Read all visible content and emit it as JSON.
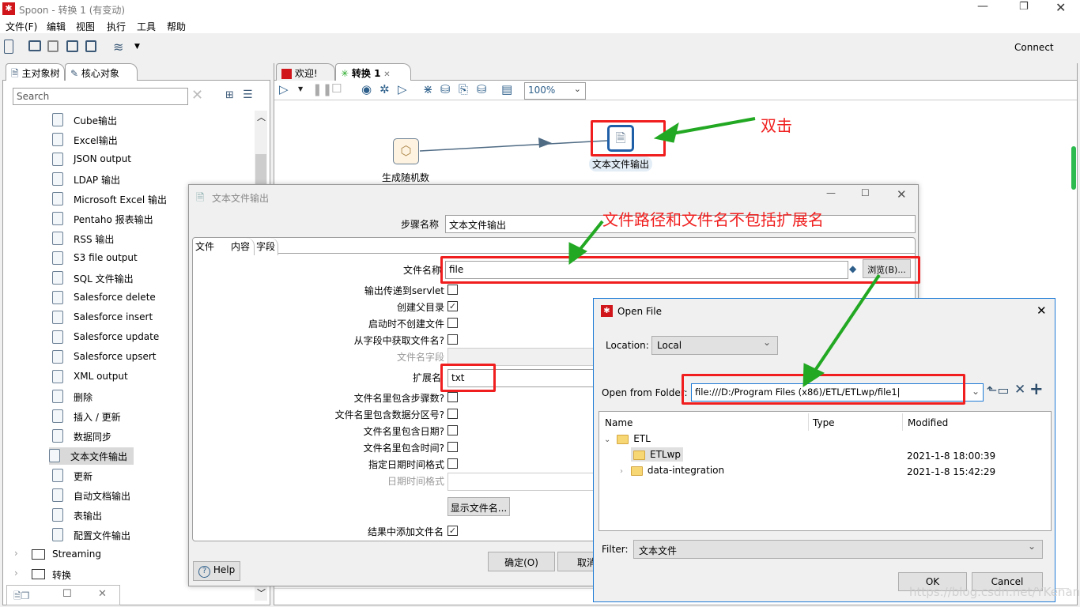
{
  "window": {
    "title": "Spoon - 转换 1 (有变动)",
    "controls": [
      "minimize-icon",
      "maximize-icon",
      "close-icon"
    ]
  },
  "menu": [
    "文件(F)",
    "编辑",
    "视图",
    "执行",
    "工具",
    "帮助"
  ],
  "toolbar": {
    "connect": "Connect"
  },
  "left_panel": {
    "tabs": [
      "主对象树",
      "核心对象"
    ],
    "search_placeholder": "Search",
    "items": [
      "Cube输出",
      "Excel输出",
      "JSON output",
      "LDAP 输出",
      "Microsoft Excel 输出",
      "Pentaho 报表输出",
      "RSS 输出",
      "S3 file output",
      "SQL 文件输出",
      "Salesforce delete",
      "Salesforce insert",
      "Salesforce update",
      "Salesforce upsert",
      "XML output",
      "删除",
      "插入 / 更新",
      "数据同步",
      "文本文件输出",
      "更新",
      "自动文档输出",
      "表输出",
      "配置文件输出"
    ],
    "selected_item": "文本文件输出",
    "folders": [
      "Streaming",
      "转换"
    ]
  },
  "editor": {
    "tabs": [
      "欢迎!",
      "转换 1"
    ],
    "zoom": "100%",
    "nodes": [
      {
        "label": "生成随机数"
      },
      {
        "label": "文本文件输出"
      }
    ]
  },
  "annotations": {
    "double_click": "双击",
    "note": "文件路径和文件名不包括扩展名"
  },
  "step_dialog": {
    "title": "文本文件输出",
    "step_name_label": "步骤名称",
    "step_name": "文本文件输出",
    "tabs": [
      "文件",
      "内容",
      "字段"
    ],
    "filename_label": "文件名称",
    "filename": "file",
    "browse": "浏览(B)...",
    "checks": [
      {
        "label": "输出传递到servlet",
        "checked": false
      },
      {
        "label": "创建父目录",
        "checked": true
      },
      {
        "label": "启动时不创建文件",
        "checked": false
      },
      {
        "label": "从字段中获取文件名?",
        "checked": false
      }
    ],
    "filename_field_label": "文件名字段",
    "extension_label": "扩展名",
    "extension": "txt",
    "checks2": [
      {
        "label": "文件名里包含步骤数?",
        "checked": false
      },
      {
        "label": "文件名里包含数据分区号?",
        "checked": false
      },
      {
        "label": "文件名里包含日期?",
        "checked": false
      },
      {
        "label": "文件名里包含时间?",
        "checked": false
      },
      {
        "label": "指定日期时间格式",
        "checked": false
      }
    ],
    "date_format_label": "日期时间格式",
    "show_filename": "显示文件名...",
    "add_to_result_label": "结果中添加文件名",
    "add_to_result": true,
    "help": "Help",
    "ok": "确定(O)",
    "cancel": "取消"
  },
  "open_file": {
    "title": "Open File",
    "location_label": "Location:",
    "location": "Local",
    "folder_label": "Open from Folder:",
    "folder": "file:///D:/Program Files (x86)/ETL/ETLwp/file1",
    "columns": [
      "Name",
      "Type",
      "Modified"
    ],
    "rows": [
      {
        "name": "ETL",
        "type": "",
        "modified": "",
        "expanded": true
      },
      {
        "name": "ETLwp",
        "type": "",
        "modified": "2021-1-8 18:00:39",
        "selected": true
      },
      {
        "name": "data-integration",
        "type": "",
        "modified": "2021-1-8 15:42:29"
      }
    ],
    "filter_label": "Filter:",
    "filter": "文本文件",
    "ok": "OK",
    "cancel": "Cancel"
  },
  "watermark": "https://blog.csdn.net/YKenan",
  "colors": {
    "annotation_red": "#f01e1e",
    "arrow_green": "#22a822",
    "node_blue": "#1f5fa8"
  }
}
